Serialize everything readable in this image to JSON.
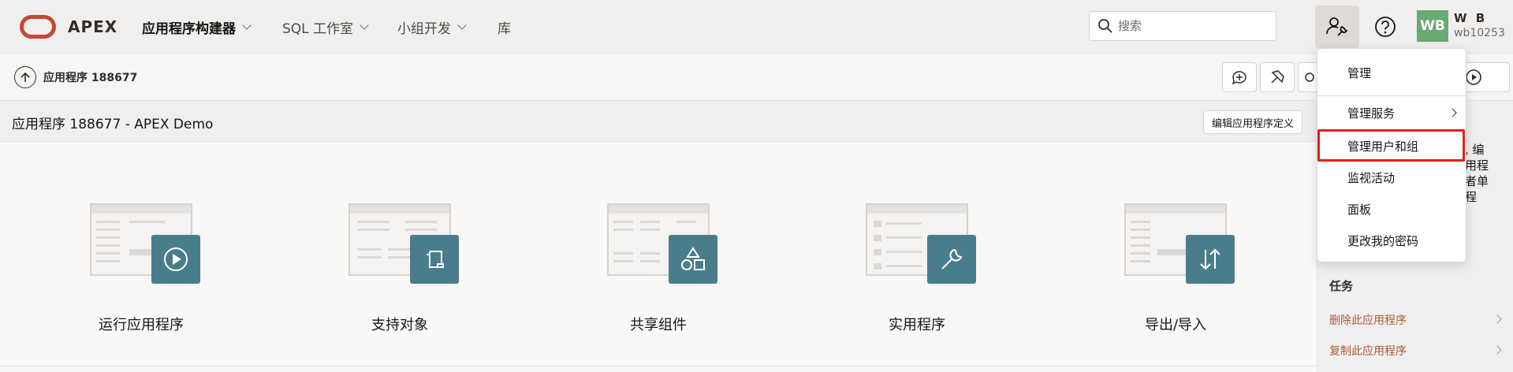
{
  "header": {
    "brand": "APEX",
    "nav": [
      {
        "label": "应用程序构建器",
        "active": true
      },
      {
        "label": "SQL 工作室",
        "active": false
      },
      {
        "label": "小组开发",
        "active": false
      },
      {
        "label": "库",
        "active": false
      }
    ],
    "search_placeholder": "搜索",
    "user": {
      "initials": "WB",
      "name": "W B",
      "id": "wb10253"
    }
  },
  "breadcrumb": {
    "label": "应用程序 188677"
  },
  "region": {
    "title": "应用程序 188677 - APEX Demo",
    "edit_button": "编辑应用程序定义"
  },
  "tiles": [
    {
      "label": "运行应用程序",
      "icon": "play-icon"
    },
    {
      "label": "支持对象",
      "icon": "scroll-icon"
    },
    {
      "label": "共享组件",
      "icon": "shapes-icon"
    },
    {
      "label": "实用程序",
      "icon": "wrench-icon"
    },
    {
      "label": "导出/导入",
      "icon": "transfer-icon"
    }
  ],
  "side_panel": {
    "partial_lines": [
      "了, 编",
      "应用程",
      "或者单",
      "用程"
    ],
    "tasks_title": "任务",
    "tasks": [
      "删除此应用程序",
      "复制此应用程序"
    ]
  },
  "menu": {
    "items": [
      "管理",
      "管理服务",
      "管理用户和组",
      "监视活动",
      "面板",
      "更改我的密码"
    ],
    "highlighted_item": "管理用户和组"
  },
  "colors": {
    "brand_red": "#c74634",
    "tile_teal": "#4a7d8c",
    "avatar_green": "#6aa974",
    "link_brown": "#a55b38",
    "highlight_red": "#e0201b"
  }
}
